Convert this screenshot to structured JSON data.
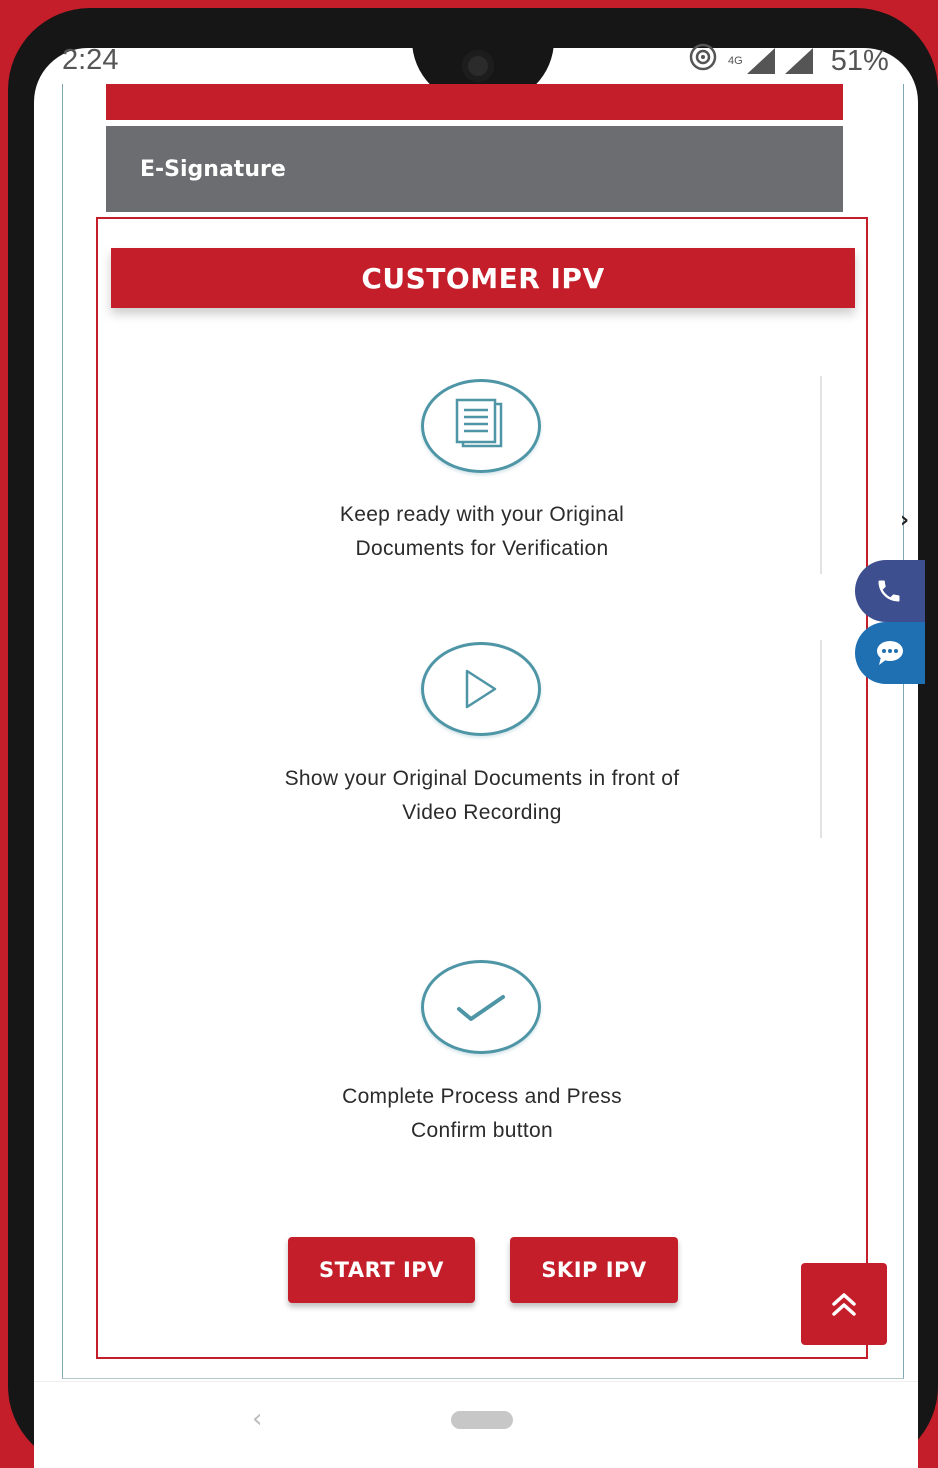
{
  "status": {
    "time": "2:24",
    "network": "4G",
    "battery": "51%"
  },
  "esignature_label": "E-Signature",
  "ipv": {
    "title": "CUSTOMER IPV",
    "steps": [
      {
        "icon": "document-icon",
        "line1": "Keep ready with your Original",
        "line2": "Documents for Verification"
      },
      {
        "icon": "play-icon",
        "line1": "Show your Original Documents in front of",
        "line2": "Video Recording"
      },
      {
        "icon": "check-icon",
        "line1": "Complete Process and Press",
        "line2": "Confirm button"
      }
    ],
    "start_label": "START IPV",
    "skip_label": "SKIP IPV"
  },
  "floating": {
    "call_icon": "phone-icon",
    "chat_icon": "chat-icon",
    "scroll_icon": "double-chevron-up-icon"
  },
  "colors": {
    "brand_red": "#c41e2a",
    "esign_gray": "#6b6d70",
    "icon_teal": "#4e95a6",
    "call_blue": "#3e4f8f",
    "chat_blue": "#1f6fb3"
  }
}
